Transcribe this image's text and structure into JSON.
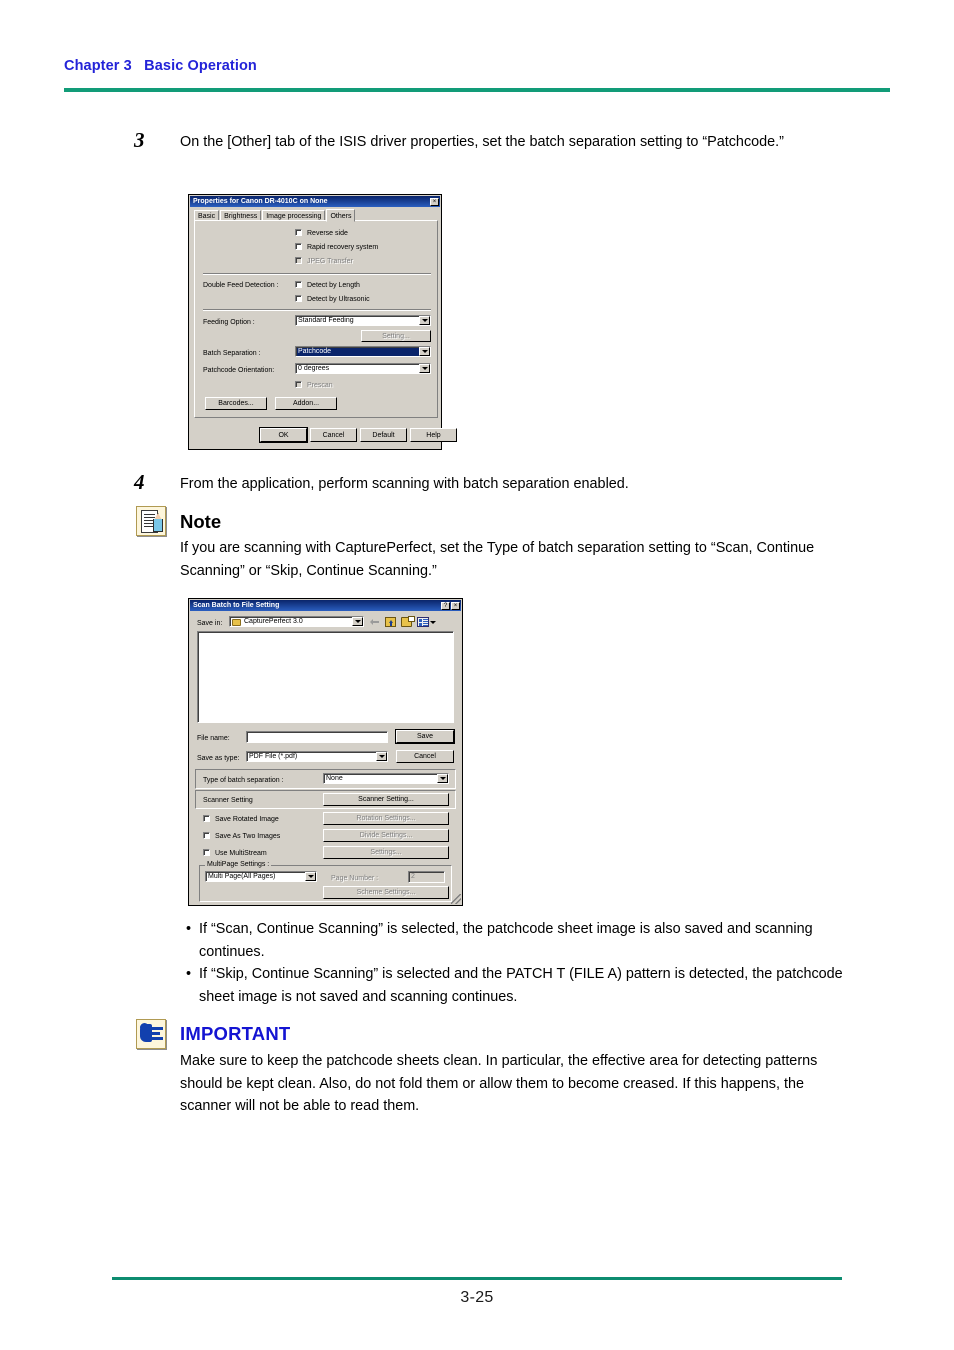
{
  "header": {
    "chapter": "Chapter 3",
    "section": "Basic Operation",
    "rule_color": "#129c78"
  },
  "footer": {
    "page_number": "3-25",
    "rule_color": "#0d8c70"
  },
  "steps": [
    {
      "number": "3",
      "text": "On the [Other] tab of the ISIS driver properties, set the batch separation setting to “Patchcode.”"
    },
    {
      "number": "4",
      "text": "From the application, perform scanning with batch separation enabled."
    }
  ],
  "note": {
    "icon": "note-document-pencil-icon",
    "title": "Note",
    "text": "If you are scanning with CapturePerfect, set the Type of batch separation setting to “Scan, Continue Scanning” or “Skip, Continue Scanning.”"
  },
  "bullets": [
    "If “Scan, Continue Scanning” is selected, the patchcode sheet image is also saved and scanning continues.",
    "If “Skip, Continue Scanning” is selected and the PATCH T (FILE A) pattern is detected, the patchcode sheet image is not saved and scanning continues."
  ],
  "important": {
    "icon": "important-hand-icon",
    "title": "IMPORTANT",
    "title_color": "#1414d2",
    "text": "Make sure to keep the patchcode sheets clean. In particular, the effective area for detecting patterns should be kept clean. Also, do not fold them or allow them to become creased. If this happens, the scanner will not be able to read them."
  },
  "dialog_properties": {
    "title": "Properties for Canon DR-4010C on None",
    "close_label": "×",
    "tabs": [
      {
        "label": "Basic",
        "active": false
      },
      {
        "label": "Brightness",
        "active": false
      },
      {
        "label": "Image processing",
        "active": false
      },
      {
        "label": "Others",
        "active": true
      }
    ],
    "checkboxes": [
      {
        "label": "Reverse side",
        "checked": false,
        "enabled": true
      },
      {
        "label": "Rapid recovery system",
        "checked": false,
        "enabled": true
      },
      {
        "label": "JPEG Transfer",
        "checked": false,
        "enabled": false
      }
    ],
    "double_feed_label": "Double Feed Detection :",
    "double_feed_options": [
      {
        "label": "Detect by Length",
        "checked": false,
        "enabled": true
      },
      {
        "label": "Detect by Ultrasonic",
        "checked": false,
        "enabled": true
      }
    ],
    "feeding_option_label": "Feeding Option :",
    "feeding_option_value": "Standard Feeding",
    "setting_button": "Setting...",
    "batch_separation_label": "Batch Separation :",
    "batch_separation_value": "Patchcode",
    "patchcode_orientation_label": "Patchcode Orientation:",
    "patchcode_orientation_value": "0 degrees",
    "prescan_label": "Prescan",
    "barcodes_button": "Barcodes...",
    "addon_button": "Addon...",
    "ok_button": "OK",
    "cancel_button": "Cancel",
    "default_button": "Default",
    "help_button": "Help"
  },
  "dialog_scan_batch": {
    "title": "Scan Batch to File Setting",
    "help_label": "?",
    "close_label": "×",
    "save_in_label": "Save in:",
    "save_in_value": "CapturePerfect 3.0",
    "toolbar_icons": [
      "back-arrow-icon",
      "up-one-level-icon",
      "create-new-folder-icon",
      "views-icon"
    ],
    "file_name_label": "File name:",
    "file_name_value": "",
    "save_as_type_label": "Save as type:",
    "save_as_type_value": "PDF File (*.pdf)",
    "save_button": "Save",
    "cancel_button": "Cancel",
    "batch_separation_label": "Type of batch separation :",
    "batch_separation_value": "None",
    "scanner_setting_label": "Scanner Setting",
    "scanner_setting_button": "Scanner Setting...",
    "options": [
      {
        "label": "Save Rotated Image",
        "checked": false,
        "button": "Rotation Settings...",
        "button_enabled": false
      },
      {
        "label": "Save As Two Images",
        "checked": false,
        "button": "Divide Settings...",
        "button_enabled": false
      },
      {
        "label": "Use MultiStream",
        "checked": false,
        "button": "Settings...",
        "button_enabled": false
      }
    ],
    "multipage_group_label": "MultiPage Settings :",
    "multipage_value": "Multi Page(All Pages)",
    "page_number_label": "Page Number :",
    "page_number_value": "2",
    "scheme_settings_button": "Scheme Settings..."
  }
}
